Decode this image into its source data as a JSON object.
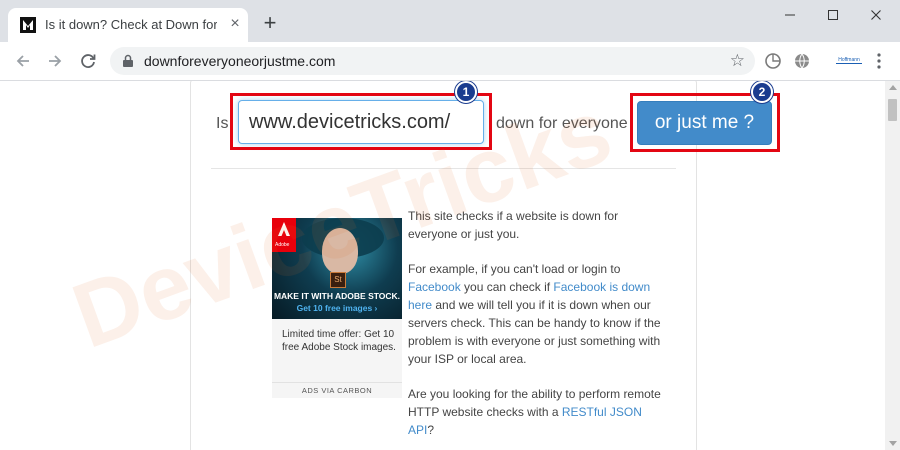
{
  "browser": {
    "tab": {
      "title": "Is it down? Check at Down for Everyone or Just Me",
      "close_glyph": "×"
    },
    "new_tab_glyph": "+",
    "address": {
      "url": "downforeveryoneorjustme.com",
      "star_glyph": "☆"
    },
    "extension_badge": "Hoffmann"
  },
  "checker": {
    "prefix": "Is",
    "url_value": "www.devicetricks.com/",
    "suffix": "down for everyone",
    "button_label": "or just me ?"
  },
  "annotations": {
    "marker1": "1",
    "marker2": "2",
    "highlight_color": "#e30613",
    "marker_color": "#1a3c8f"
  },
  "ad": {
    "brand": "Adobe",
    "badge": "St",
    "headline": "MAKE IT WITH ADOBE STOCK.",
    "subline": "Get 10 free images ›",
    "text": "Limited time offer: Get 10 free Adobe Stock images.",
    "footer": "ADS VIA CARBON"
  },
  "description": {
    "p1": "This site checks if a website is down for everyone or just you.",
    "p2": {
      "t1": "For example, if you can't load or login to ",
      "l1": "Facebook",
      "t2": " you can check if ",
      "l2": "Facebook is down here",
      "t3": " and we will tell you if it is down when our servers check. This can be handy to know if the problem is with everyone or just something with your ISP or local area."
    },
    "p3": {
      "t1": "Are you looking for the ability to perform remote HTTP website checks with a ",
      "l1": "RESTful JSON API",
      "t2": "?"
    }
  },
  "watermark": "DeviceTricks",
  "colors": {
    "accent": "#428bca",
    "link": "#428bca"
  }
}
